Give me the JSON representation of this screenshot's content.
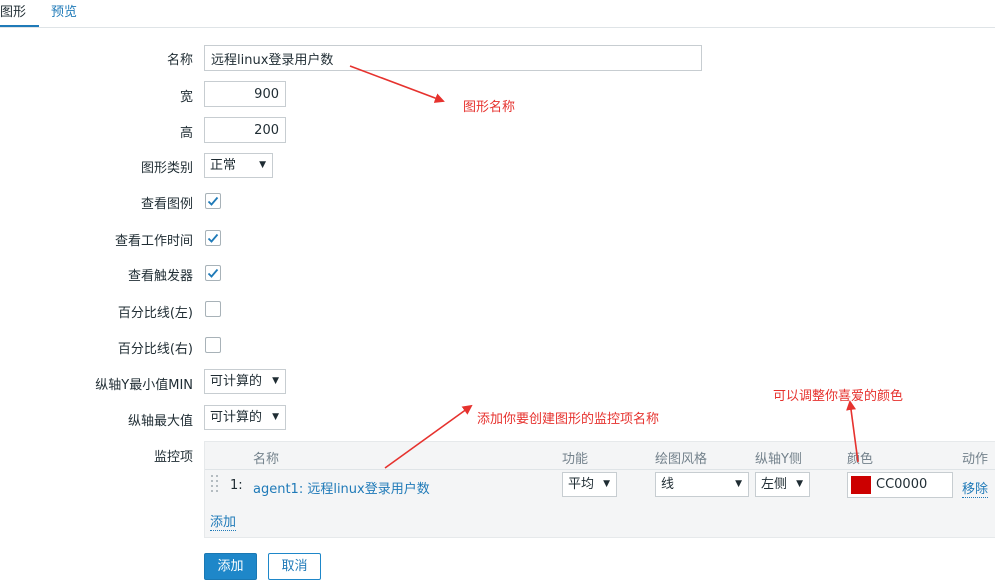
{
  "tabs": {
    "graph": "图形",
    "preview": "预览"
  },
  "form": {
    "name_label": "名称",
    "name_value": "远程linux登录用户数",
    "width_label": "宽",
    "width_value": "900",
    "height_label": "高",
    "height_value": "200",
    "type_label": "图形类别",
    "type_value": "正常",
    "legend_label": "查看图例",
    "legend_checked": true,
    "worktime_label": "查看工作时间",
    "worktime_checked": true,
    "triggers_label": "查看触发器",
    "triggers_checked": true,
    "percent_left_label": "百分比线(左)",
    "percent_left_checked": false,
    "percent_right_label": "百分比线(右)",
    "percent_right_checked": false,
    "ymin_label": "纵轴Y最小值MIN",
    "ymin_value": "可计算的",
    "ymax_label": "纵轴最大值",
    "ymax_value": "可计算的",
    "items_label": "监控项"
  },
  "items_table": {
    "headers": {
      "name": "名称",
      "function": "功能",
      "style": "绘图风格",
      "yaxis": "纵轴Y侧",
      "color": "颜色",
      "action": "动作"
    },
    "rows": [
      {
        "index": "1:",
        "name": "agent1: 远程linux登录用户数",
        "function": "平均",
        "style": "线",
        "yaxis": "左侧",
        "color_hex": "#CC0000",
        "color_text": "CC0000",
        "action": "移除"
      }
    ],
    "add_link": "添加"
  },
  "buttons": {
    "add": "添加",
    "cancel": "取消"
  },
  "annotations": {
    "graph_name": "图形名称",
    "item_name": "添加你要创建图形的监控项名称",
    "color": "可以调整你喜爱的颜色"
  },
  "colors": {
    "accent": "#1f7ab8",
    "annotation": "#e6322e",
    "check": "#1f7ab8"
  }
}
